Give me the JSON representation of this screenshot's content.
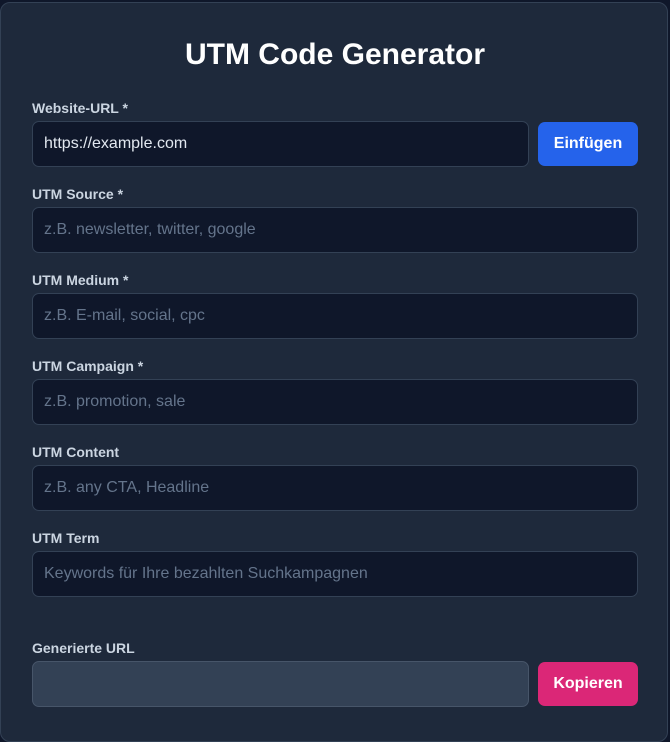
{
  "title": "UTM Code Generator",
  "fields": {
    "website_url": {
      "label": "Website-URL *",
      "value": "https://example.com",
      "placeholder": ""
    },
    "utm_source": {
      "label": "UTM Source *",
      "value": "",
      "placeholder": "z.B. newsletter, twitter, google"
    },
    "utm_medium": {
      "label": "UTM Medium *",
      "value": "",
      "placeholder": "z.B. E-mail, social, cpc"
    },
    "utm_campaign": {
      "label": "UTM Campaign *",
      "value": "",
      "placeholder": "z.B. promotion, sale"
    },
    "utm_content": {
      "label": "UTM Content",
      "value": "",
      "placeholder": "z.B. any CTA, Headline"
    },
    "utm_term": {
      "label": "UTM Term",
      "value": "",
      "placeholder": "Keywords für Ihre bezahlten Suchkampagnen"
    },
    "generated_url": {
      "label": "Generierte URL",
      "value": ""
    }
  },
  "buttons": {
    "paste_label": "Einfügen",
    "copy_label": "Kopieren"
  },
  "colors": {
    "background": "#1e293b",
    "input_background": "#0f172a",
    "paste_button": "#2563eb",
    "copy_button": "#db2777"
  }
}
